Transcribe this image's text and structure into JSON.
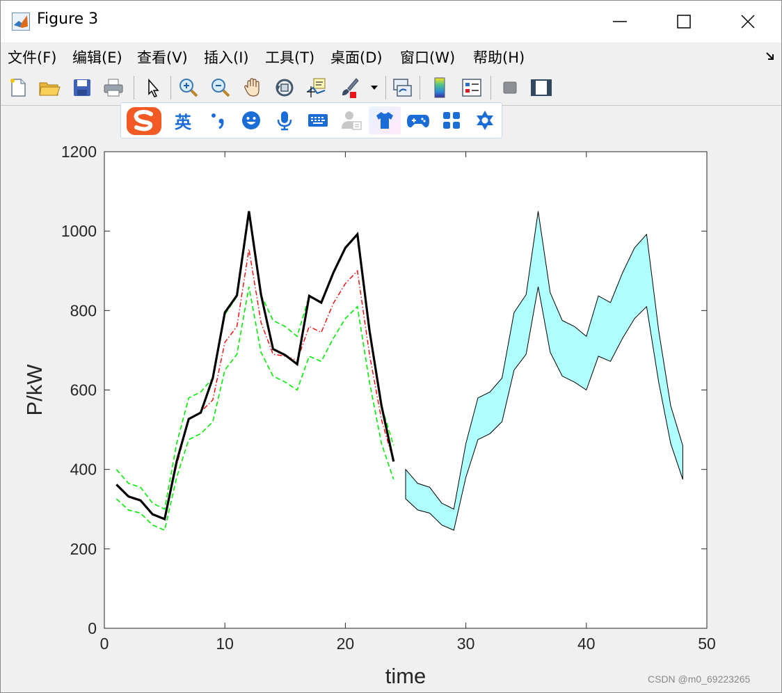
{
  "window": {
    "title": "Figure 3",
    "buttons": [
      "minimize-icon",
      "maximize-icon",
      "close-icon"
    ]
  },
  "menu": {
    "items": [
      "文件(F)",
      "编辑(E)",
      "查看(V)",
      "插入(I)",
      "工具(T)",
      "桌面(D)",
      "窗口(W)",
      "帮助(H)"
    ],
    "dock_icon": "dock-arrow-icon"
  },
  "toolbar": {
    "icons": [
      "new-figure-icon",
      "open-icon",
      "save-icon",
      "print-icon",
      "pointer-icon",
      "zoom-in-icon",
      "zoom-out-icon",
      "pan-hand-icon",
      "rotate-3d-icon",
      "data-cursor-icon",
      "brush-icon",
      "brush-dropdown-icon",
      "link-plot-icon",
      "colorbar-icon",
      "legend-icon",
      "hide-plot-tools-icon",
      "show-plot-tools-icon"
    ]
  },
  "ime": {
    "lang_label": "英",
    "icons": [
      "sogou-logo-icon",
      "punctuation-icon",
      "emoji-icon",
      "microphone-icon",
      "keyboard-icon",
      "account-icon",
      "skin-icon",
      "game-icon",
      "apps-icon",
      "toolbox-icon"
    ]
  },
  "chart_data": {
    "type": "line",
    "title": "",
    "xlabel": "time",
    "ylabel": "P/kW",
    "xlim": [
      0,
      50
    ],
    "ylim": [
      0,
      1200
    ],
    "xticks": [
      0,
      10,
      20,
      30,
      40,
      50
    ],
    "yticks": [
      0,
      200,
      400,
      600,
      800,
      1000,
      1200
    ],
    "grid": false,
    "colors": {
      "actual": "#000000",
      "forecast": "#ff0000",
      "bounds": "#00ee00",
      "band_fill": "#b0ffff",
      "band_edge": "#000000"
    },
    "series": [
      {
        "style": "solid-black",
        "x": [
          1,
          2,
          3,
          4,
          5,
          6,
          7,
          8,
          9,
          10,
          11,
          12,
          13,
          14,
          15,
          16,
          17,
          18,
          19,
          20,
          21,
          22,
          23,
          24
        ],
        "values": [
          362,
          332,
          322,
          287,
          275,
          420,
          527,
          543,
          630,
          795,
          838,
          1050,
          840,
          703,
          688,
          665,
          837,
          820,
          895,
          958,
          992,
          750,
          560,
          420
        ]
      },
      {
        "style": "dash-dot-red",
        "x": [
          1,
          2,
          3,
          4,
          5,
          6,
          7,
          8,
          9,
          10,
          11,
          12,
          13,
          14,
          15,
          16,
          17,
          18,
          19,
          20,
          21,
          22,
          23,
          24
        ],
        "values": [
          360,
          330,
          320,
          285,
          275,
          410,
          525,
          545,
          575,
          720,
          760,
          955,
          770,
          690,
          685,
          675,
          760,
          745,
          818,
          868,
          900,
          690,
          525,
          420
        ]
      },
      {
        "style": "dashed-green-upper",
        "x": [
          1,
          2,
          3,
          4,
          5,
          6,
          7,
          8,
          9,
          10,
          11,
          12,
          13,
          14,
          15,
          16,
          17,
          18,
          19,
          20,
          21,
          22,
          23,
          24
        ],
        "values": [
          400,
          365,
          355,
          315,
          300,
          465,
          580,
          595,
          630,
          790,
          835,
          1050,
          840,
          775,
          760,
          735,
          837,
          820,
          895,
          958,
          992,
          750,
          560,
          460
        ]
      },
      {
        "style": "dashed-green-lower",
        "x": [
          1,
          2,
          3,
          4,
          5,
          6,
          7,
          8,
          9,
          10,
          11,
          12,
          13,
          14,
          15,
          16,
          17,
          18,
          19,
          20,
          21,
          22,
          23,
          24
        ],
        "values": [
          326,
          298,
          290,
          260,
          247,
          380,
          475,
          490,
          520,
          650,
          690,
          860,
          695,
          635,
          620,
          600,
          685,
          672,
          730,
          780,
          810,
          620,
          465,
          375
        ]
      },
      {
        "style": "filled-band",
        "x": [
          25,
          26,
          27,
          28,
          29,
          30,
          31,
          32,
          33,
          34,
          35,
          36,
          37,
          38,
          39,
          40,
          41,
          42,
          43,
          44,
          45,
          46,
          47,
          48
        ],
        "upper": [
          400,
          365,
          355,
          315,
          300,
          465,
          580,
          595,
          630,
          795,
          840,
          1050,
          845,
          775,
          760,
          735,
          837,
          820,
          895,
          958,
          992,
          750,
          560,
          460
        ],
        "lower": [
          326,
          298,
          290,
          260,
          247,
          380,
          475,
          490,
          520,
          650,
          690,
          860,
          695,
          635,
          620,
          600,
          685,
          672,
          730,
          780,
          810,
          620,
          465,
          375
        ]
      }
    ]
  },
  "watermark": "CSDN @m0_69223265"
}
